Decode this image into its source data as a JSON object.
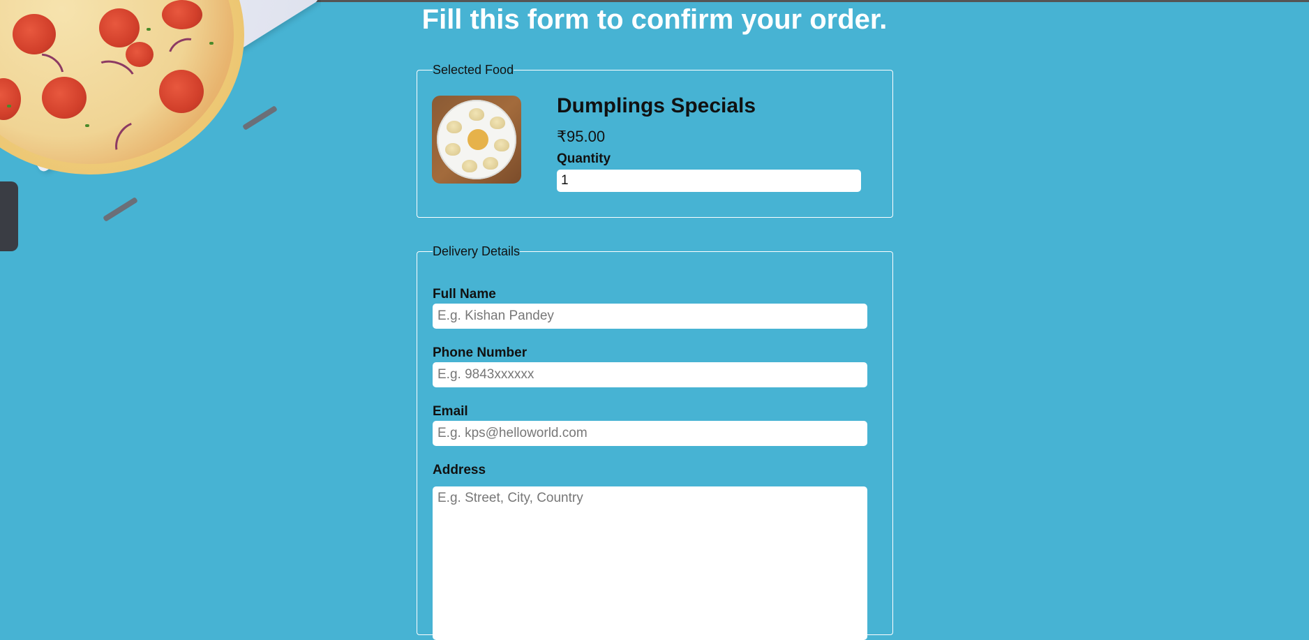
{
  "page": {
    "title": "Fill this form to confirm your order."
  },
  "selected_food": {
    "legend": "Selected Food",
    "name": "Dumplings Specials",
    "price": "₹95.00",
    "quantity_label": "Quantity",
    "quantity_value": "1"
  },
  "delivery": {
    "legend": "Delivery Details",
    "full_name_label": "Full Name",
    "full_name_placeholder": "E.g. Kishan Pandey",
    "phone_label": "Phone Number",
    "phone_placeholder": "E.g. 9843xxxxxx",
    "email_label": "Email",
    "email_placeholder": "E.g. kps@helloworld.com",
    "address_label": "Address",
    "address_placeholder": "E.g. Street, City, Country"
  },
  "colors": {
    "background": "#47b3d3",
    "title_text": "#ffffff",
    "fieldset_border": "#ffffff"
  },
  "icons": {
    "background_image": "pizza-image",
    "food_image": "dumplings-image"
  }
}
